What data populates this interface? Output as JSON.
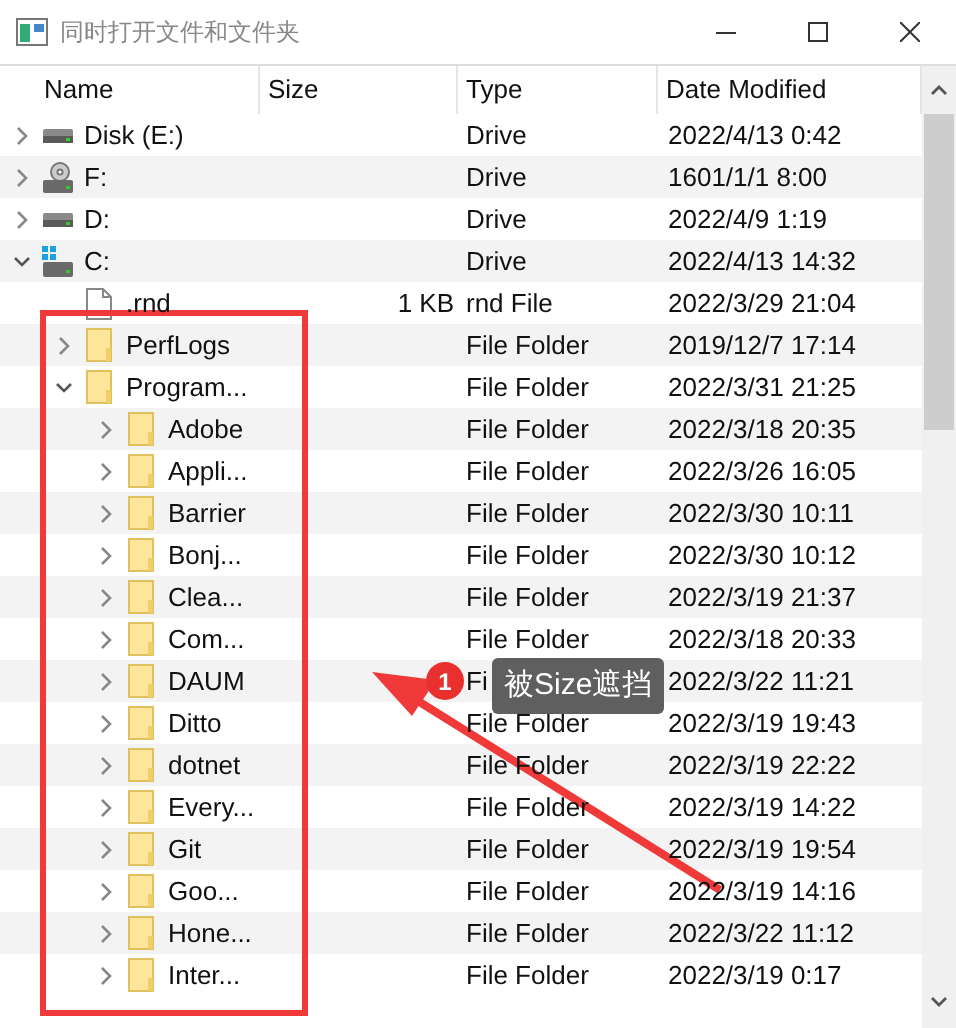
{
  "window": {
    "title": "同时打开文件和文件夹"
  },
  "columns": [
    "Name",
    "Size",
    "Type",
    "Date Modified"
  ],
  "tree": [
    {
      "name": "Disk (E:)",
      "kind": "drive",
      "type": "Drive",
      "date": "2022/4/13 0:42",
      "expanded": false
    },
    {
      "name": "F:",
      "kind": "disc",
      "type": "Drive",
      "date": "1601/1/1 8:00",
      "expanded": false
    },
    {
      "name": "D:",
      "kind": "drive",
      "type": "Drive",
      "date": "2022/4/9 1:19",
      "expanded": false
    },
    {
      "name": "C:",
      "kind": "system",
      "type": "Drive",
      "date": "2022/4/13 14:32",
      "expanded": true,
      "children": [
        {
          "name": ".rnd",
          "kind": "file",
          "size": "1 KB",
          "type": "rnd File",
          "date": "2022/3/29 21:04"
        },
        {
          "name": "PerfLogs",
          "kind": "folder",
          "type": "File Folder",
          "date": "2019/12/7 17:14",
          "expanded": false
        },
        {
          "name": "Program...",
          "kind": "folder",
          "type": "File Folder",
          "date": "2022/3/31 21:25",
          "expanded": true,
          "children": [
            {
              "name": "Adobe",
              "kind": "folder",
              "type": "File Folder",
              "date": "2022/3/18 20:35",
              "expanded": false
            },
            {
              "name": "Appli...",
              "kind": "folder",
              "type": "File Folder",
              "date": "2022/3/26 16:05",
              "expanded": false
            },
            {
              "name": "Barrier",
              "kind": "folder",
              "type": "File Folder",
              "date": "2022/3/30 10:11",
              "expanded": false
            },
            {
              "name": "Bonj...",
              "kind": "folder",
              "type": "File Folder",
              "date": "2022/3/30 10:12",
              "expanded": false
            },
            {
              "name": "Clea...",
              "kind": "folder",
              "type": "File Folder",
              "date": "2022/3/19 21:37",
              "expanded": false
            },
            {
              "name": "Com...",
              "kind": "folder",
              "type": "File Folder",
              "date": "2022/3/18 20:33",
              "expanded": false
            },
            {
              "name": "DAUM",
              "kind": "folder",
              "type": "Fi",
              "date": "2022/3/22 11:21",
              "expanded": false
            },
            {
              "name": "Ditto",
              "kind": "folder",
              "type": "File Folder",
              "date": "2022/3/19 19:43",
              "expanded": false
            },
            {
              "name": "dotnet",
              "kind": "folder",
              "type": "File Folder",
              "date": "2022/3/19 22:22",
              "expanded": false
            },
            {
              "name": "Every...",
              "kind": "folder",
              "type": "File Folder",
              "date": "2022/3/19 14:22",
              "expanded": false
            },
            {
              "name": "Git",
              "kind": "folder",
              "type": "File Folder",
              "date": "2022/3/19 19:54",
              "expanded": false
            },
            {
              "name": "Goo...",
              "kind": "folder",
              "type": "File Folder",
              "date": "2022/3/19 14:16",
              "expanded": false
            },
            {
              "name": "Hone...",
              "kind": "folder",
              "type": "File Folder",
              "date": "2022/3/22 11:12",
              "expanded": false
            },
            {
              "name": "Inter...",
              "kind": "folder",
              "type": "File Folder",
              "date": "2022/3/19 0:17",
              "expanded": false
            }
          ]
        }
      ]
    }
  ],
  "annotation": {
    "badge": "1",
    "label": "被Size遮挡"
  }
}
